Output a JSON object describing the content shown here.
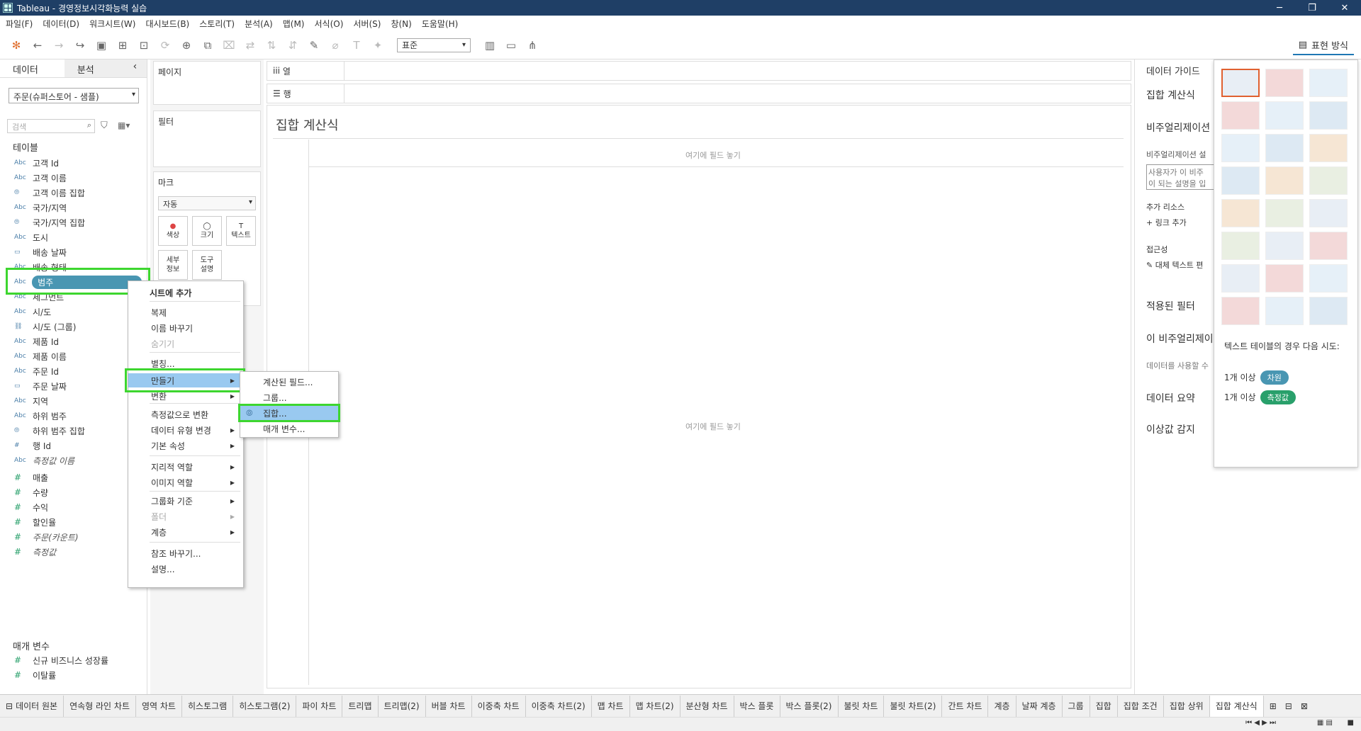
{
  "window": {
    "title": "Tableau - 경영정보시각화능력 실습"
  },
  "menu": [
    "파일(F)",
    "데이터(D)",
    "워크시트(W)",
    "대시보드(B)",
    "스토리(T)",
    "분석(A)",
    "맵(M)",
    "서식(O)",
    "서버(S)",
    "창(N)",
    "도움말(H)"
  ],
  "toolbar": {
    "fit": "표준",
    "show_me": "표현 방식"
  },
  "left": {
    "tab_data": "데이터",
    "tab_analysis": "분석",
    "datasource": "주문(슈퍼스토어 - 샘플)",
    "search_placeholder": "검색",
    "tables_header": "테이블",
    "fields": [
      {
        "t": "Abc",
        "n": "고객 Id"
      },
      {
        "t": "Abc",
        "n": "고객 이름"
      },
      {
        "t": "set",
        "n": "고객 이름 집합"
      },
      {
        "t": "Abc",
        "n": "국가/지역"
      },
      {
        "t": "set",
        "n": "국가/지역 집합"
      },
      {
        "t": "Abc",
        "n": "도시"
      },
      {
        "t": "date",
        "n": "배송 날짜"
      },
      {
        "t": "Abc",
        "n": "배송 형태"
      },
      {
        "t": "Abc",
        "n": "범주"
      },
      {
        "t": "Abc",
        "n": "세그먼트"
      },
      {
        "t": "Abc",
        "n": "시/도"
      },
      {
        "t": "clip",
        "n": "시/도 (그룹)"
      },
      {
        "t": "Abc",
        "n": "제품 Id"
      },
      {
        "t": "Abc",
        "n": "제품 이름"
      },
      {
        "t": "Abc",
        "n": "주문 Id"
      },
      {
        "t": "date",
        "n": "주문 날짜"
      },
      {
        "t": "Abc",
        "n": "지역"
      },
      {
        "t": "Abc",
        "n": "하위 범주"
      },
      {
        "t": "set",
        "n": "하위 범주 집합"
      },
      {
        "t": "#",
        "n": "행 Id"
      },
      {
        "t": "Abc",
        "n": "측정값 이름"
      }
    ],
    "measures": [
      {
        "t": "#",
        "n": "매출"
      },
      {
        "t": "#",
        "n": "수량"
      },
      {
        "t": "#",
        "n": "수익"
      },
      {
        "t": "#",
        "n": "할인율"
      },
      {
        "t": "#",
        "n": "주문(카운트)"
      },
      {
        "t": "#",
        "n": "측정값"
      }
    ],
    "params_header": "매개 변수",
    "params": [
      {
        "t": "#",
        "n": "신규 비즈니스 성장률"
      },
      {
        "t": "#",
        "n": "이탈률"
      }
    ]
  },
  "shelves": {
    "pages": "페이지",
    "filters": "필터",
    "marks": "마크",
    "mark_type": "자동",
    "color": "색상",
    "size": "크기",
    "text": "텍스트",
    "detail": "세부\n정보",
    "tooltip": "도구\n설명",
    "columns": "열",
    "rows": "행"
  },
  "canvas": {
    "title": "집합 계산식",
    "drop_hint": "여기에 필드 놓기"
  },
  "guide": {
    "header": "데이터 가이드",
    "title": "집합 계산식",
    "viz_header": "비주얼리제이션",
    "viz_desc": "비주얼리제이션 설",
    "placeholder": "사용자가 이 비주\n이 되는 설명을 입",
    "add_res": "추가 리소스",
    "link": "링크 추가",
    "access": "접근성",
    "alt": "대체 텍스트 편",
    "filters": "적용된 필터",
    "this_viz": "이 비주얼리제이",
    "use_data": "데이터를 사용할 수",
    "summary": "데이터 요약",
    "outliers": "이상값 감지"
  },
  "showme": {
    "hint": "텍스트 테이블의 경우 다음 시도:",
    "dim_pre": "1개 이상",
    "dim": "차원",
    "mea_pre": "1개 이상",
    "mea": "측정값"
  },
  "ctx": {
    "items": [
      "시트에 추가",
      "복제",
      "이름 바꾸기",
      "숨기기",
      "별칭...",
      "만들기",
      "변환",
      "측정값으로 변환",
      "데이터 유형 변경",
      "기본 속성",
      "지리적 역할",
      "이미지 역할",
      "그룹화 기준",
      "폴더",
      "계층",
      "참조 바꾸기...",
      "설명..."
    ],
    "sub": [
      "계산된 필드...",
      "그룹...",
      "집합...",
      "매개 변수..."
    ]
  },
  "tabs": [
    "데이터 원본",
    "연속형 라인 차트",
    "영역 차트",
    "히스토그램",
    "히스토그램(2)",
    "파이 차트",
    "트리맵",
    "트리맵(2)",
    "버블 차트",
    "이중축 차트",
    "이중축 차트(2)",
    "맵 차트",
    "맵 차트(2)",
    "분산형 차트",
    "박스 플롯",
    "박스 플롯(2)",
    "불릿 차트",
    "불릿 차트(2)",
    "간트 차트",
    "계층",
    "날짜 계층",
    "그룹",
    "집합",
    "집합 조건",
    "집합 상위",
    "집합 계산식"
  ],
  "colors": {
    "accent": "#4996b2",
    "highlight": "#3dd62f",
    "dim_pill": "#4996b2",
    "mea_pill": "#29a06b"
  }
}
